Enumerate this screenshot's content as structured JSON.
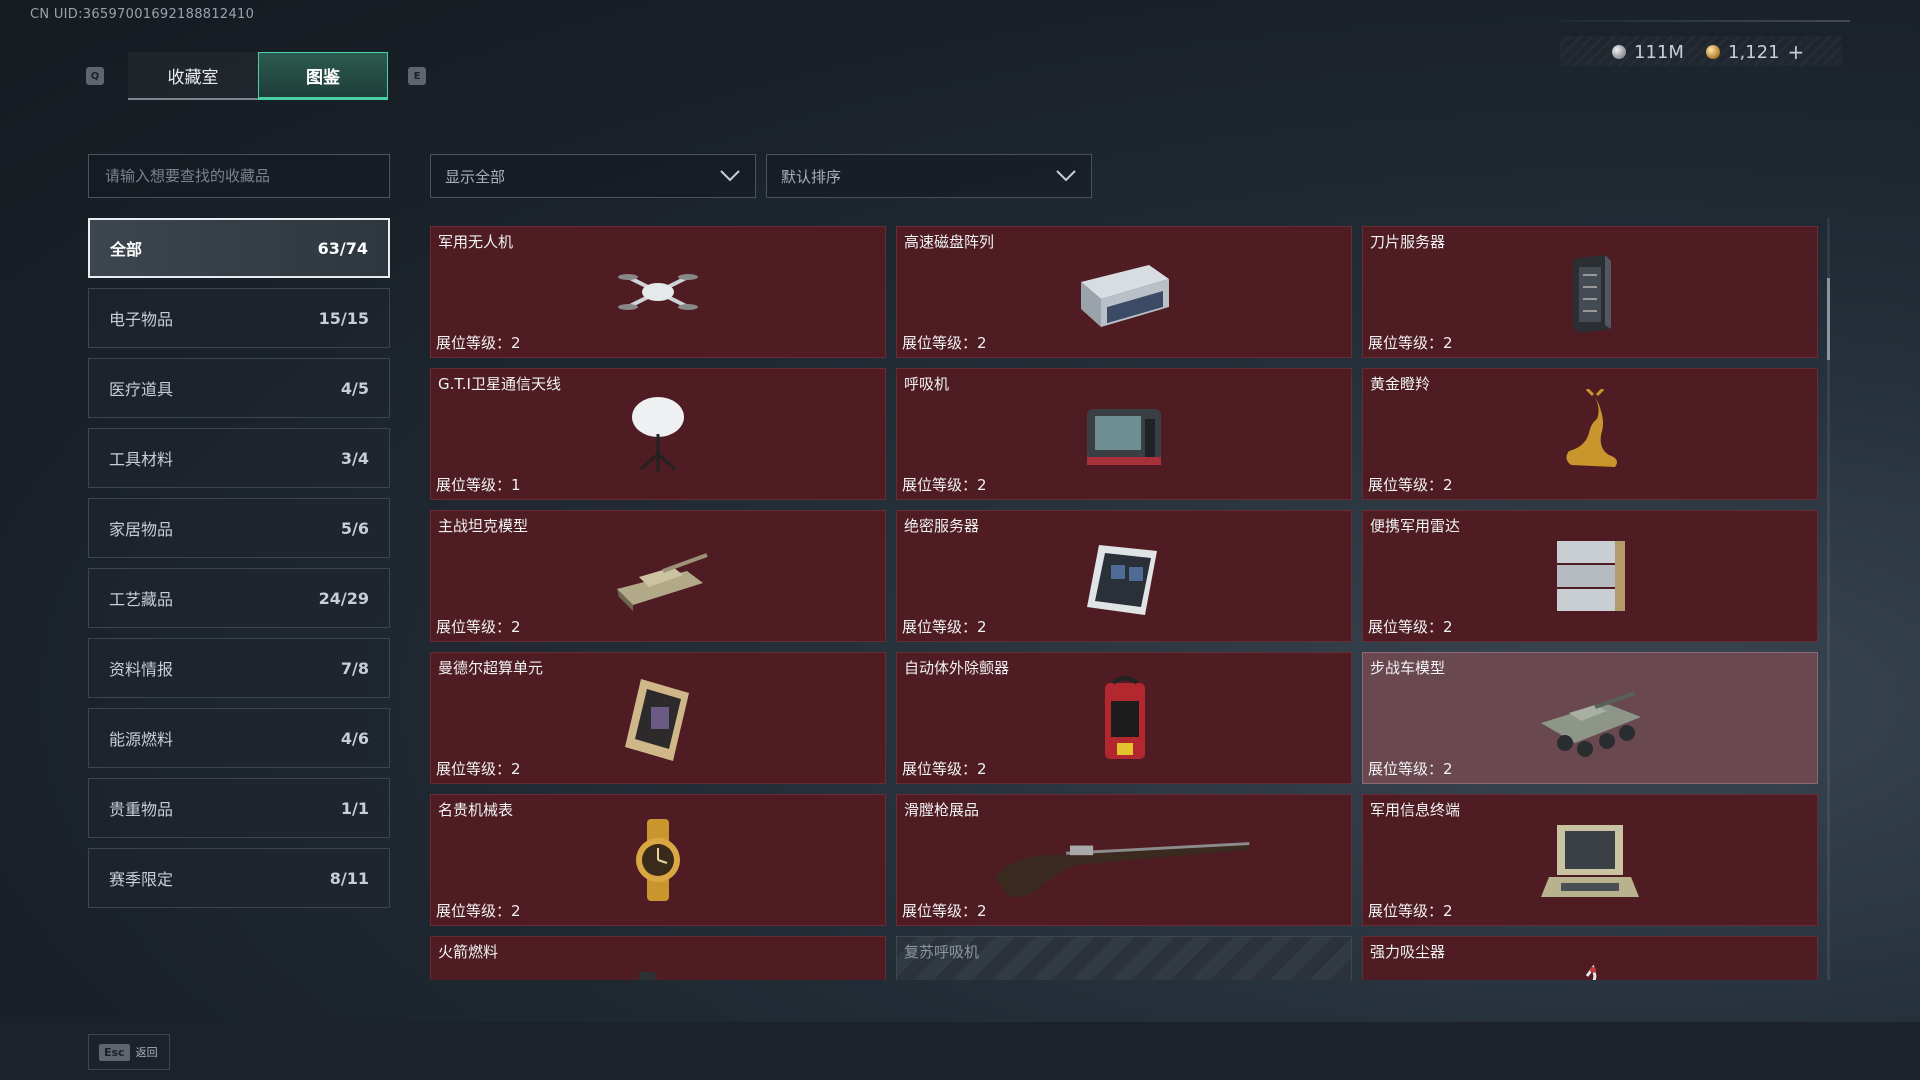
{
  "header": {
    "uid": "CN UID:36597001692188812410",
    "currency_silver": "111M",
    "currency_gold": "1,121",
    "plus_label": "+",
    "key_left": "Q",
    "key_right": "E",
    "tabs": [
      {
        "label": "收藏室",
        "active": false
      },
      {
        "label": "图鉴",
        "active": true
      }
    ]
  },
  "search": {
    "placeholder": "请输入想要查找的收藏品"
  },
  "filters": {
    "display": "显示全部",
    "sort": "默认排序"
  },
  "categories": [
    {
      "label": "全部",
      "count": "63/74",
      "active": true
    },
    {
      "label": "电子物品",
      "count": "15/15"
    },
    {
      "label": "医疗道具",
      "count": "4/5"
    },
    {
      "label": "工具材料",
      "count": "3/4"
    },
    {
      "label": "家居物品",
      "count": "5/6"
    },
    {
      "label": "工艺藏品",
      "count": "24/29"
    },
    {
      "label": "资料情报",
      "count": "7/8"
    },
    {
      "label": "能源燃料",
      "count": "4/6"
    },
    {
      "label": "贵重物品",
      "count": "1/1"
    },
    {
      "label": "赛季限定",
      "count": "8/11"
    }
  ],
  "items": [
    {
      "name": "军用无人机",
      "level": "展位等级：2",
      "icon": "drone-icon"
    },
    {
      "name": "高速磁盘阵列",
      "level": "展位等级：2",
      "icon": "disk-array-icon"
    },
    {
      "name": "刀片服务器",
      "level": "展位等级：2",
      "icon": "blade-server-icon"
    },
    {
      "name": "G.T.I卫星通信天线",
      "level": "展位等级：1",
      "icon": "satellite-antenna-icon"
    },
    {
      "name": "呼吸机",
      "level": "展位等级：2",
      "icon": "ventilator-icon"
    },
    {
      "name": "黄金瞪羚",
      "level": "展位等级：2",
      "icon": "gold-gazelle-icon"
    },
    {
      "name": "主战坦克模型",
      "level": "展位等级：2",
      "icon": "tank-model-icon"
    },
    {
      "name": "绝密服务器",
      "level": "展位等级：2",
      "icon": "secret-server-icon"
    },
    {
      "name": "便携军用雷达",
      "level": "展位等级：2",
      "icon": "portable-radar-icon"
    },
    {
      "name": "曼德尔超算单元",
      "level": "展位等级：2",
      "icon": "supercomputer-unit-icon"
    },
    {
      "name": "自动体外除颤器",
      "level": "展位等级：2",
      "icon": "defibrillator-icon"
    },
    {
      "name": "步战车模型",
      "level": "展位等级：2",
      "icon": "ifv-model-icon"
    },
    {
      "name": "名贵机械表",
      "level": "展位等级：2",
      "icon": "watch-icon"
    },
    {
      "name": "滑膛枪展品",
      "level": "展位等级：2",
      "icon": "musket-icon"
    },
    {
      "name": "军用信息终端",
      "level": "展位等级：2",
      "icon": "terminal-icon"
    },
    {
      "name": "火箭燃料",
      "level": "",
      "icon": "fuel-can-icon"
    },
    {
      "name": "复苏呼吸机",
      "level": "",
      "icon": "resuscitator-icon"
    },
    {
      "name": "强力吸尘器",
      "level": "",
      "icon": "vacuum-icon"
    }
  ],
  "footer": {
    "esc_key": "Esc",
    "esc_label": "返回"
  },
  "colors": {
    "accent": "#4ad1a5",
    "card_bg": "#4e1c22",
    "card_highlight": "#6a4850"
  }
}
